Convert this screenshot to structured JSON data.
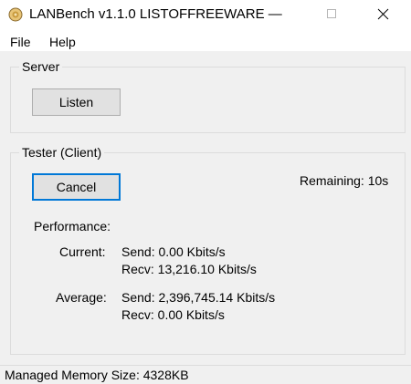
{
  "window": {
    "title": "LANBench v1.1.0  LISTOFFREEWARE —",
    "app_icon": "lanbench-app-icon",
    "controls": {
      "maximize_icon": "maximize-icon",
      "close_icon": "close-icon"
    }
  },
  "menu": {
    "items": [
      {
        "label": "File"
      },
      {
        "label": "Help"
      }
    ]
  },
  "server": {
    "group_label": "Server",
    "listen_label": "Listen"
  },
  "tester": {
    "group_label": "Tester (Client)",
    "cancel_label": "Cancel",
    "remaining": "Remaining: 10s",
    "performance_label": "Performance:",
    "current": {
      "label": "Current:",
      "send": "Send: 0.00 Kbits/s",
      "recv": "Recv: 13,216.10 Kbits/s"
    },
    "average": {
      "label": "Average:",
      "send": "Send: 2,396,745.14 Kbits/s",
      "recv": "Recv: 0.00 Kbits/s"
    }
  },
  "status": {
    "text": "Managed Memory Size: 4328KB"
  },
  "colors": {
    "window_bg": "#f0f0f0",
    "focus_border": "#0078d7",
    "button_bg": "#e1e1e1"
  }
}
